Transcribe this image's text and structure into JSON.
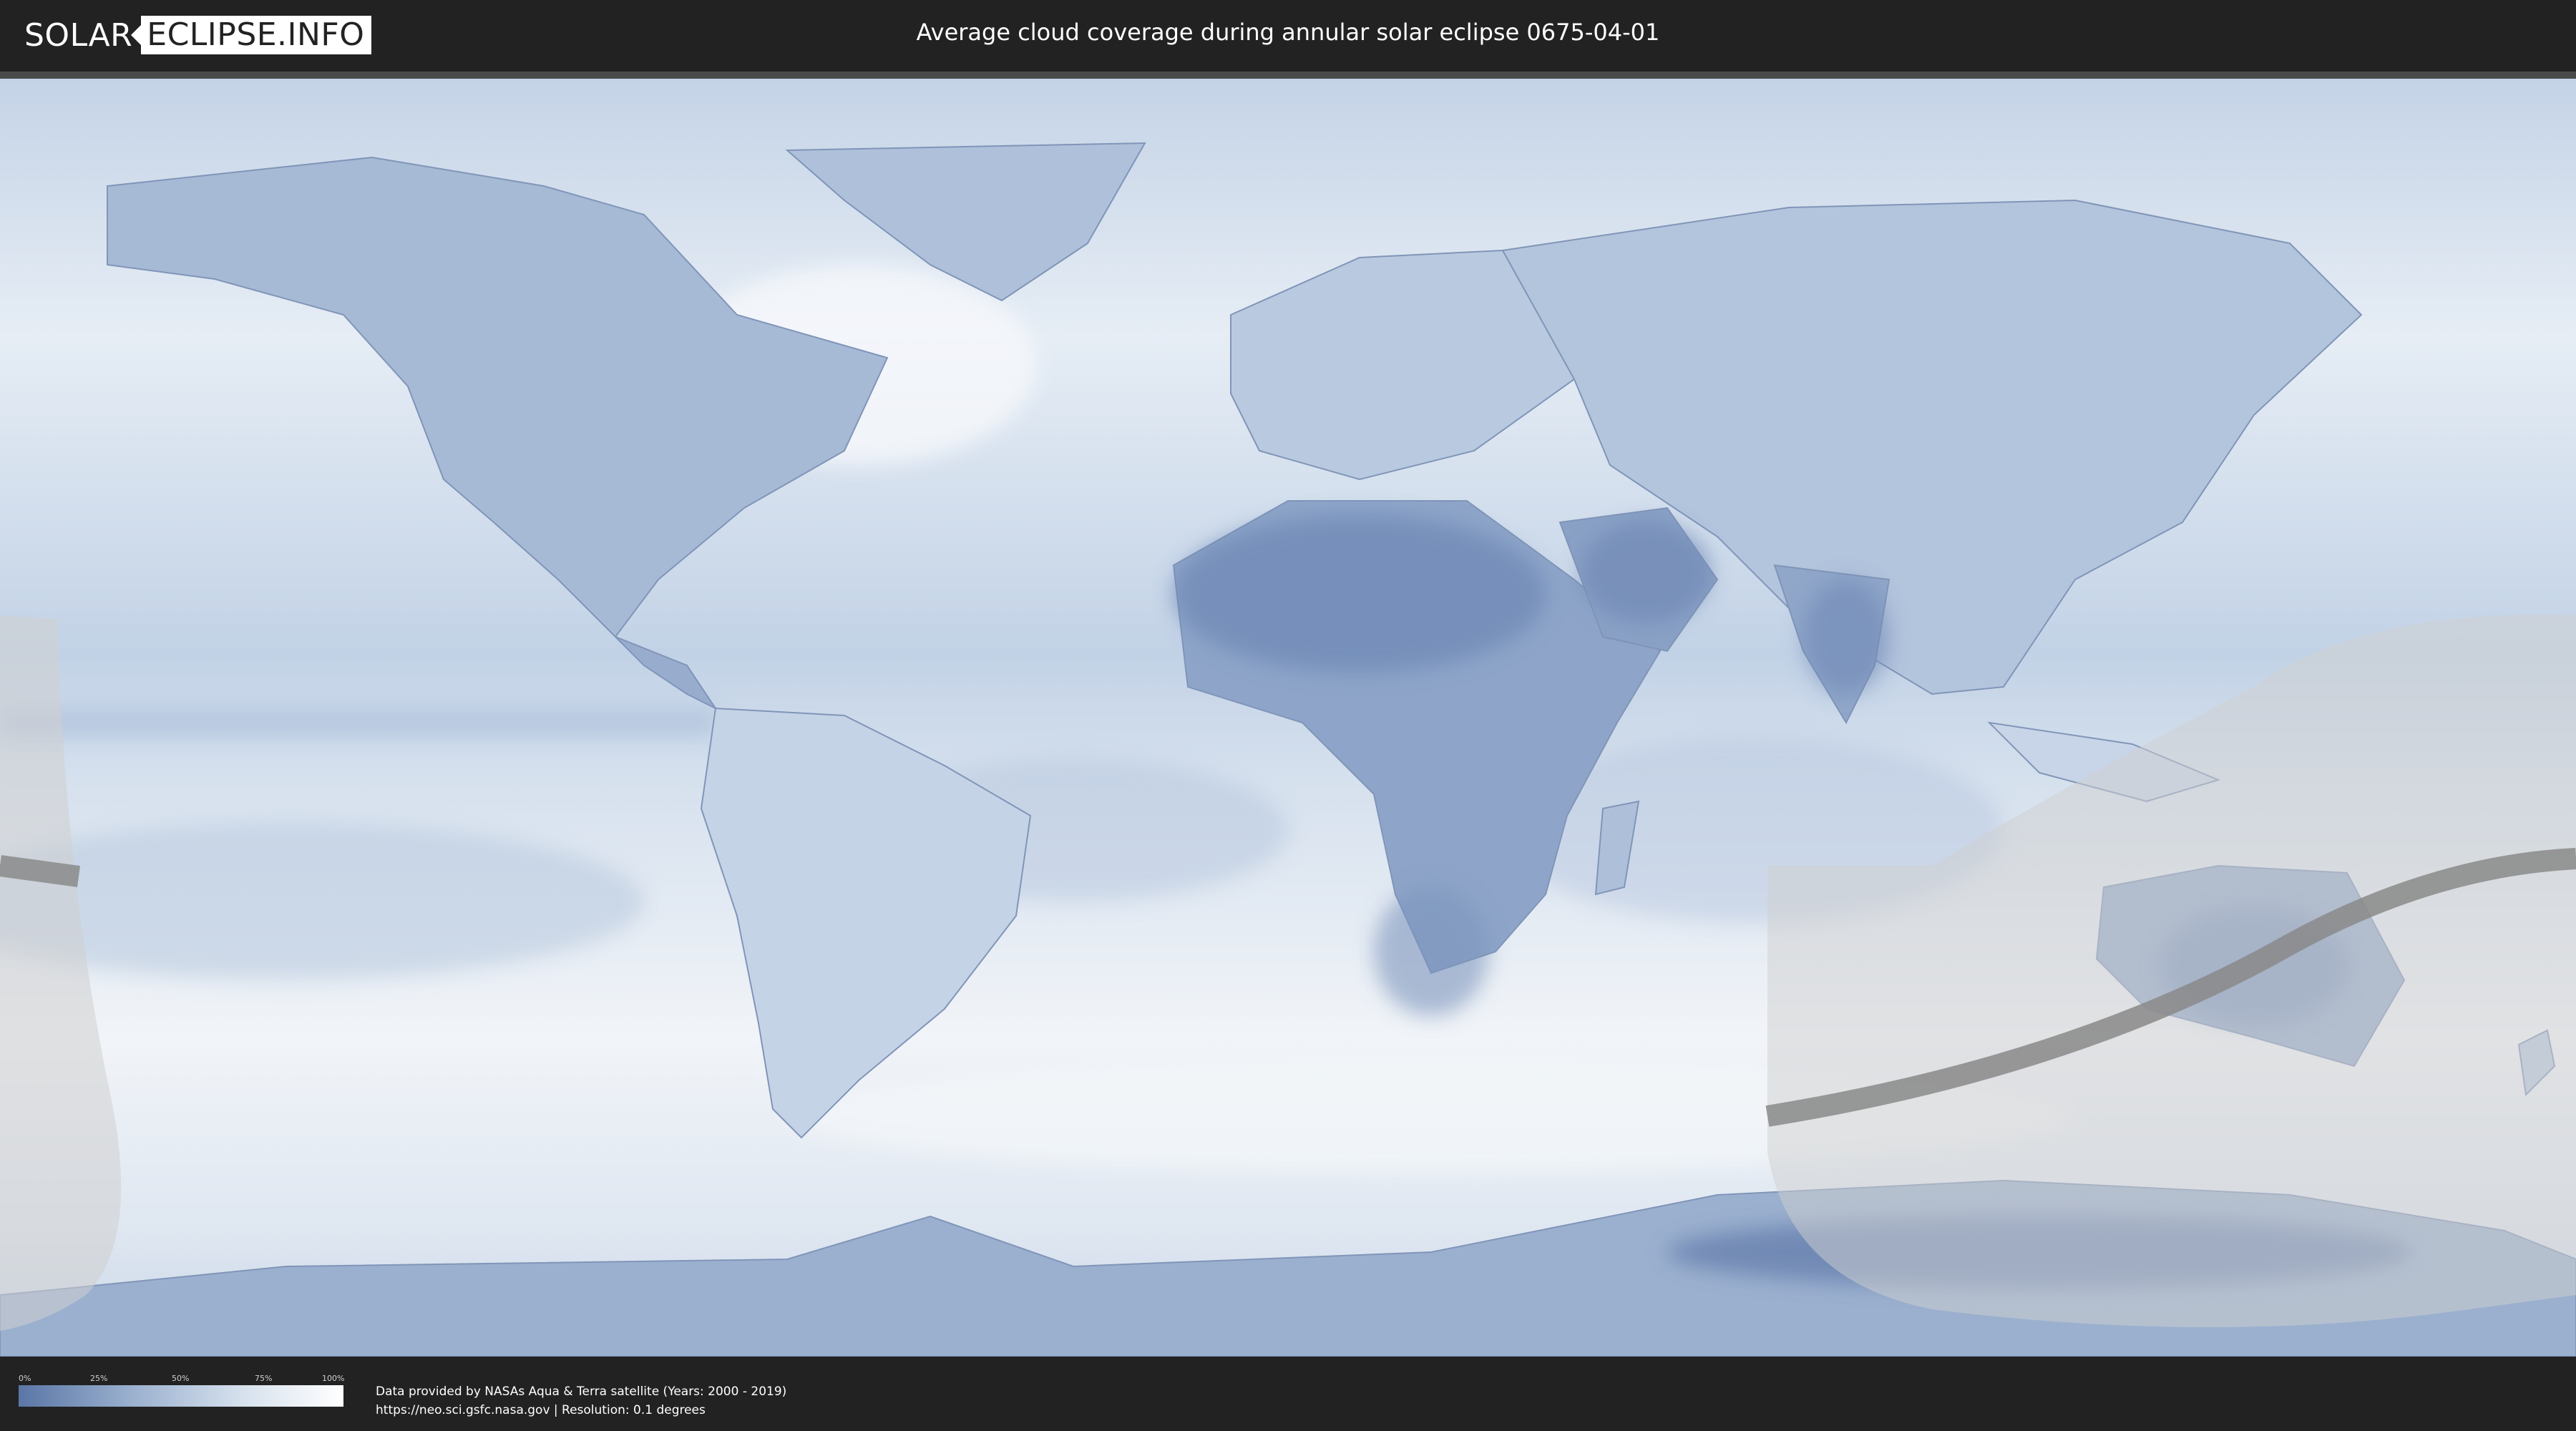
{
  "header": {
    "logo_left": "SOLAR",
    "logo_right": "ECLIPSE.INFO",
    "title": "Average cloud coverage during annular solar eclipse 0675-04-01"
  },
  "legend": {
    "ticks": [
      "0%",
      "25%",
      "50%",
      "75%",
      "100%"
    ],
    "colors": {
      "low": "#5a76a6",
      "high": "#ffffff"
    }
  },
  "footer": {
    "source_line": "Data provided by NASAs Aqua & Terra satellite (Years: 2000 - 2019)",
    "url_line": "https://neo.sci.gsfc.nasa.gov | Resolution: 0.1 degrees"
  },
  "map": {
    "colors": {
      "ocean_cloud": "#dde6f0",
      "land_clear": "#6f89b5",
      "eclipse_zone": "#cfcfcf",
      "eclipse_path": "#8a8a8a"
    }
  }
}
